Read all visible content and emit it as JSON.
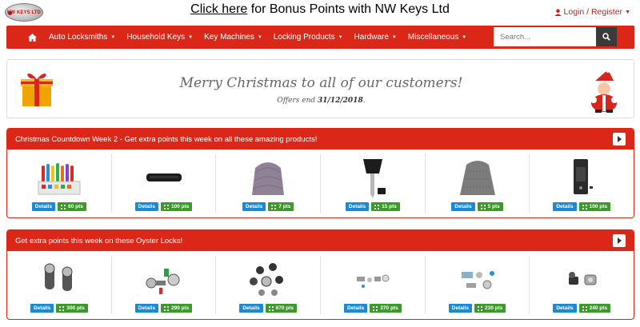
{
  "header": {
    "logo_text": "NW KEYS LTD",
    "promo_link": "Click here",
    "promo_text": " for Bonus Points with NW Keys Ltd",
    "login_label": "Login / Register"
  },
  "nav": {
    "items": [
      {
        "label": "Auto Locksmiths"
      },
      {
        "label": "Household Keys"
      },
      {
        "label": "Key Machines"
      },
      {
        "label": "Locking Products"
      },
      {
        "label": "Hardware"
      },
      {
        "label": "Miscellaneous"
      }
    ],
    "search_placeholder": "Search..."
  },
  "banner": {
    "title": "Merry Christmas to all of our customers!",
    "offers_prefix": "Offers end ",
    "offers_date": "31/12/2018",
    "offers_suffix": "."
  },
  "panels": [
    {
      "title": "Christmas Countdown Week 2 - Get extra points this week on all these amazing products!",
      "products": [
        {
          "image": "key-tags-icon",
          "details": "Details",
          "points": "60 pts"
        },
        {
          "image": "black-bar-icon",
          "details": "Details",
          "points": "100 pts"
        },
        {
          "image": "rubber-pad-icon",
          "details": "Details",
          "points": "7 pts"
        },
        {
          "image": "flip-key-icon",
          "details": "Details",
          "points": "15 pts"
        },
        {
          "image": "grey-pad-icon",
          "details": "Details",
          "points": "5 pts"
        },
        {
          "image": "key-device-icon",
          "details": "Details",
          "points": "100 pts"
        }
      ]
    },
    {
      "title": "Get extra points this week on these Oyster Locks!",
      "products": [
        {
          "image": "oyster-lock-icon",
          "details": "Details",
          "points": "300 pts"
        },
        {
          "image": "oyster-lock-set-icon",
          "details": "Details",
          "points": "290 pts"
        },
        {
          "image": "oyster-lock-kit-icon",
          "details": "Details",
          "points": "870 pts"
        },
        {
          "image": "oyster-lock-parts-icon",
          "details": "Details",
          "points": "270 pts"
        },
        {
          "image": "oyster-lock-parts-icon",
          "details": "Details",
          "points": "230 pts"
        },
        {
          "image": "oyster-lock-pair-icon",
          "details": "Details",
          "points": "240 pts"
        }
      ]
    }
  ],
  "colors": {
    "brand_red": "#db2718",
    "details_blue": "#1a8ad4",
    "points_green": "#3c9a2a"
  }
}
